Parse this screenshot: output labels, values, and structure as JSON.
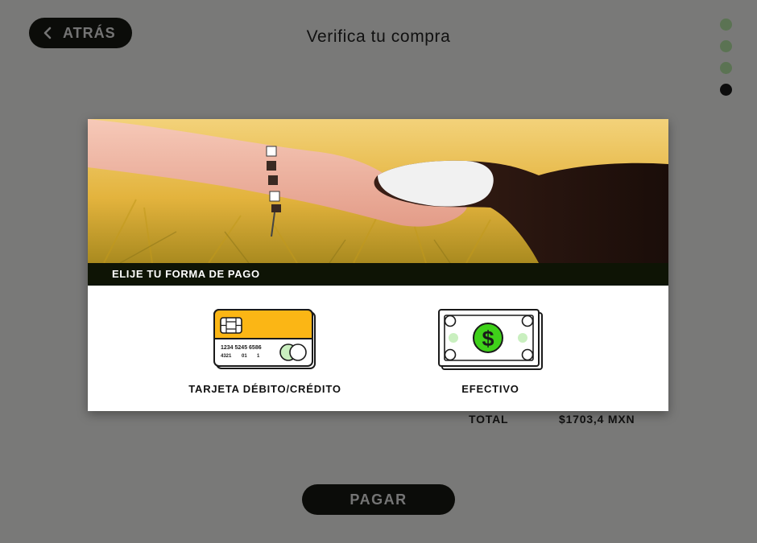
{
  "header": {
    "back_label": "ATRÁS",
    "title": "Verifica tu compra"
  },
  "stepper": {
    "steps": [
      "done",
      "done",
      "done",
      "current"
    ],
    "colors": {
      "done": "#b7e6a6",
      "current": "#1b1b1b"
    }
  },
  "summary": {
    "total_label": "TOTAL",
    "total_amount": "$1703,4 MXN"
  },
  "pay_label": "PAGAR",
  "modal": {
    "banner_title": "ELIJE TU FORMA DE PAGO",
    "options": [
      {
        "label": "TARJETA DÉBITO/CRÉDITO",
        "icon": "credit-card-icon",
        "card_number": "1234 5245 6586",
        "card_small": [
          "4321",
          "01",
          "1"
        ]
      },
      {
        "label": "EFECTIVO",
        "icon": "cash-bill-icon"
      }
    ]
  },
  "colors": {
    "dark_button": "#171912",
    "card_yellow": "#fbb615",
    "cash_green": "#3fd11a",
    "band": "#0e1405"
  }
}
